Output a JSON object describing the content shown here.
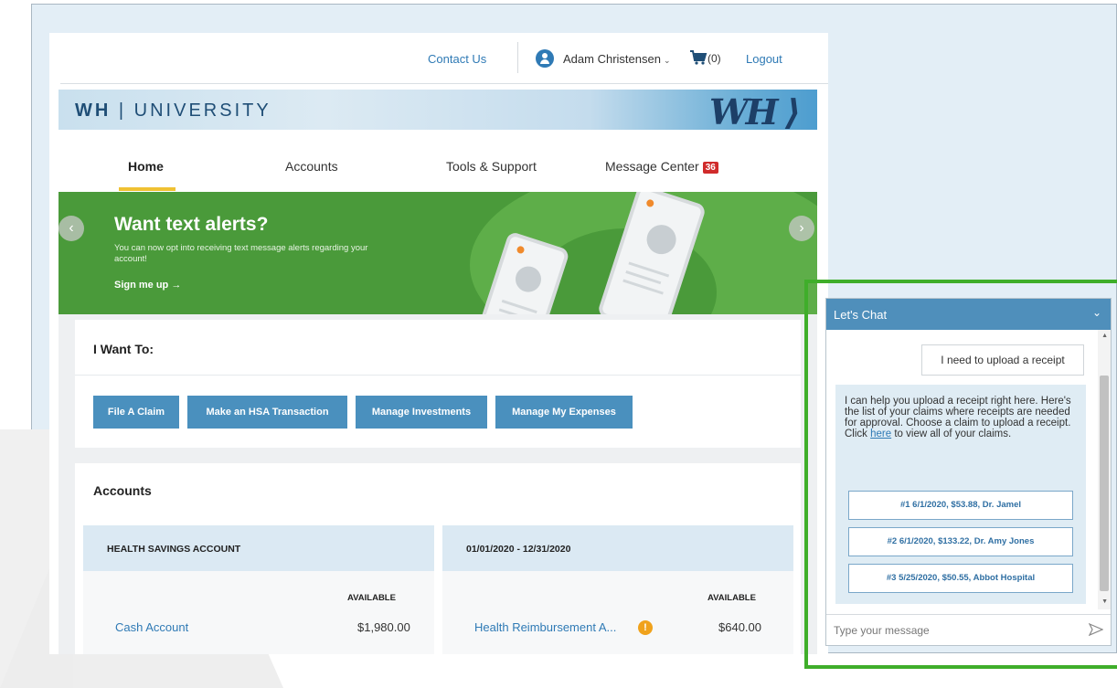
{
  "header": {
    "contact_label": "Contact Us",
    "user_name": "Adam Christensen",
    "cart_count": "(0)",
    "logout_label": "Logout"
  },
  "brand": {
    "left": "WH",
    "separator": "|",
    "right": "UNIVERSITY",
    "logo": "WH"
  },
  "nav": {
    "items": [
      {
        "label": "Home",
        "active": true
      },
      {
        "label": "Accounts"
      },
      {
        "label": "Tools & Support"
      },
      {
        "label": "Message Center",
        "badge": "36"
      }
    ]
  },
  "banner": {
    "title": "Want text alerts?",
    "subtitle": "You can now opt into receiving text message alerts regarding your account!",
    "cta": "Sign me up →",
    "prev_icon": "chevron-left-icon",
    "next_icon": "chevron-right-icon"
  },
  "want_to": {
    "title": "I Want To:",
    "actions": [
      "File A Claim",
      "Make an HSA Transaction",
      "Manage Investments",
      "Manage My Expenses"
    ]
  },
  "accounts": {
    "title": "Accounts",
    "panels": [
      {
        "heading": "HEALTH SAVINGS ACCOUNT",
        "available_label": "AVAILABLE",
        "account": "Cash Account",
        "amount": "$1,980.00"
      },
      {
        "heading": "01/01/2020 - 12/31/2020",
        "available_label": "AVAILABLE",
        "account": "Health Reimbursement A...",
        "info": "!",
        "amount": "$640.00"
      }
    ]
  },
  "chat": {
    "title": "Let's Chat",
    "collapse_icon": "chevron-down-icon",
    "user_message": "I need to upload a receipt",
    "bot_text_before": "I can help you upload a receipt right here. Here's the list of your claims where receipts are needed for approval. Choose a claim to upload a receipt. Click ",
    "bot_link": "here",
    "bot_text_after": " to view all of your claims.",
    "claims": [
      "#1 6/1/2020, $53.88, Dr. Jamel",
      "#2 6/1/2020, $133.22, Dr. Amy Jones",
      "#3 5/25/2020, $50.55, Abbot Hospital"
    ],
    "input_placeholder": "Type your message",
    "send_icon": "send-icon"
  },
  "colors": {
    "accent": "#2f7ab5",
    "button": "#4a90be",
    "banner": "#4a9a3a",
    "nav_underline": "#f0c132",
    "badge": "#d02b2b",
    "highlight_frame": "#3fae2a",
    "chat_header": "#4f8fbb"
  }
}
